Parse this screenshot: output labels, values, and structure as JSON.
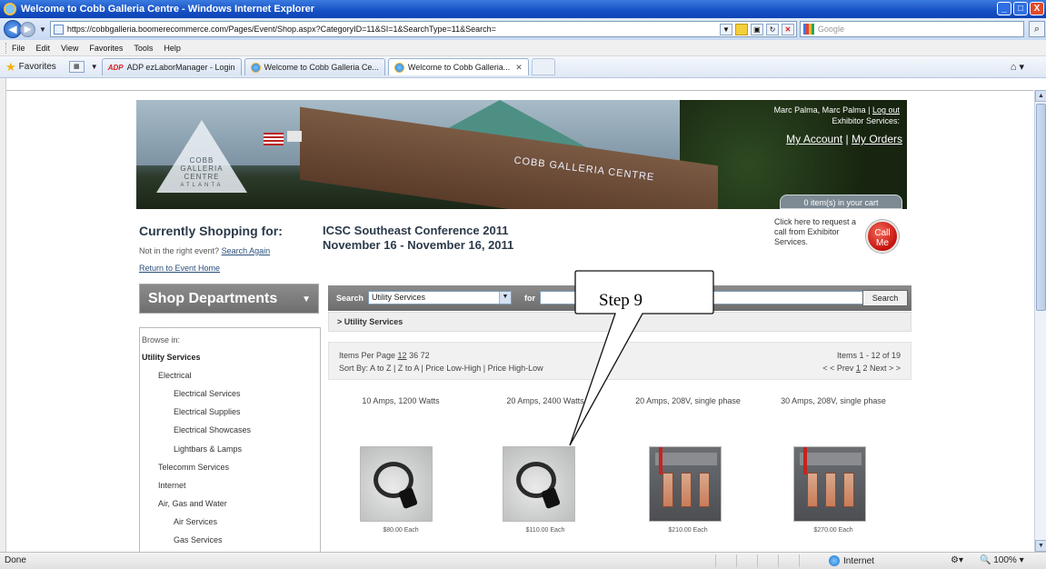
{
  "window": {
    "title": "Welcome to Cobb Galleria Centre - Windows Internet Explorer",
    "controls": [
      "_",
      "□",
      "X"
    ]
  },
  "address": {
    "url": "https://cobbgalleria.boomerecommerce.com/Pages/Event/Shop.aspx?CategoryID=11&SI=1&SearchType=11&Search=",
    "search_placeholder": "Google"
  },
  "menu": [
    "File",
    "Edit",
    "View",
    "Favorites",
    "Tools",
    "Help"
  ],
  "favorites": {
    "label": "Favorites",
    "tabs": [
      {
        "label": "ADP ezLaborManager - Login",
        "icon": "adp"
      },
      {
        "label": "Welcome to Cobb Galleria Ce...",
        "icon": "ie"
      },
      {
        "label": "Welcome to Cobb Galleria...",
        "icon": "ie",
        "active": true
      }
    ]
  },
  "banner": {
    "logo_lines": [
      "COBB",
      "GALLERIA",
      "CENTRE"
    ],
    "logo_sub": "ATLANTA",
    "sign": "COBB GALLERIA CENTRE",
    "user": "Marc Palma, Marc Palma",
    "logout": "Log out",
    "exhibitor": "Exhibitor Services:",
    "my_account": "My Account",
    "my_orders": "My Orders",
    "cart": "0 item(s) in your cart"
  },
  "shopping": {
    "title": "Currently Shopping for:",
    "not_right": "Not in the right event?",
    "search_again": "Search Again",
    "return_home": "Return to Event Home",
    "event_name": "ICSC Southeast Conference 2011",
    "event_dates": "November 16 - November 16, 2011",
    "call_text": "Click here to request a call from Exhibitor Services.",
    "call_btn_1": "Call",
    "call_btn_2": "Me"
  },
  "departments": {
    "title": "Shop Departments",
    "browse_in": "Browse in:",
    "categories": [
      {
        "label": "Utility Services",
        "level": 0,
        "bold": true
      },
      {
        "label": "Electrical",
        "level": 1
      },
      {
        "label": "Electrical Services",
        "level": 2
      },
      {
        "label": "Electrical Supplies",
        "level": 2
      },
      {
        "label": "Electrical Showcases",
        "level": 2
      },
      {
        "label": "Lightbars & Lamps",
        "level": 2
      },
      {
        "label": "Telecomm Services",
        "level": 1
      },
      {
        "label": "Internet",
        "level": 1
      },
      {
        "label": "Air, Gas and Water",
        "level": 1
      },
      {
        "label": "Air Services",
        "level": 2
      },
      {
        "label": "Gas Services",
        "level": 2
      }
    ]
  },
  "search": {
    "label": "Search",
    "category": "Utility Services",
    "for_label": "for",
    "button": "Search",
    "breadcrumb": "> Utility Services"
  },
  "paging": {
    "items_per_page": "Items Per Page",
    "per_page_options": [
      "12",
      "36",
      "72"
    ],
    "sort_by": "Sort By:",
    "sort_options": [
      "A to Z",
      "Z to A",
      "Price Low-High",
      "Price High-Low"
    ],
    "range": "Items 1 - 12 of 19",
    "prev": "< < Prev",
    "pages": [
      "1",
      "2"
    ],
    "next": "Next > >"
  },
  "products": [
    {
      "title": "10 Amps, 1200 Watts",
      "price": "$80.00 Each",
      "image": "cord"
    },
    {
      "title": "20 Amps, 2400 Watts",
      "price": "$110.00 Each",
      "image": "cord"
    },
    {
      "title": "20 Amps, 208V, single phase",
      "price": "$210.00 Each",
      "image": "panel"
    },
    {
      "title": "30 Amps, 208V, single phase",
      "price": "$270.00 Each",
      "image": "panel"
    }
  ],
  "callout": {
    "text": "Step 9"
  },
  "status": {
    "text": "Done",
    "zone": "Internet",
    "zoom": "100%"
  }
}
